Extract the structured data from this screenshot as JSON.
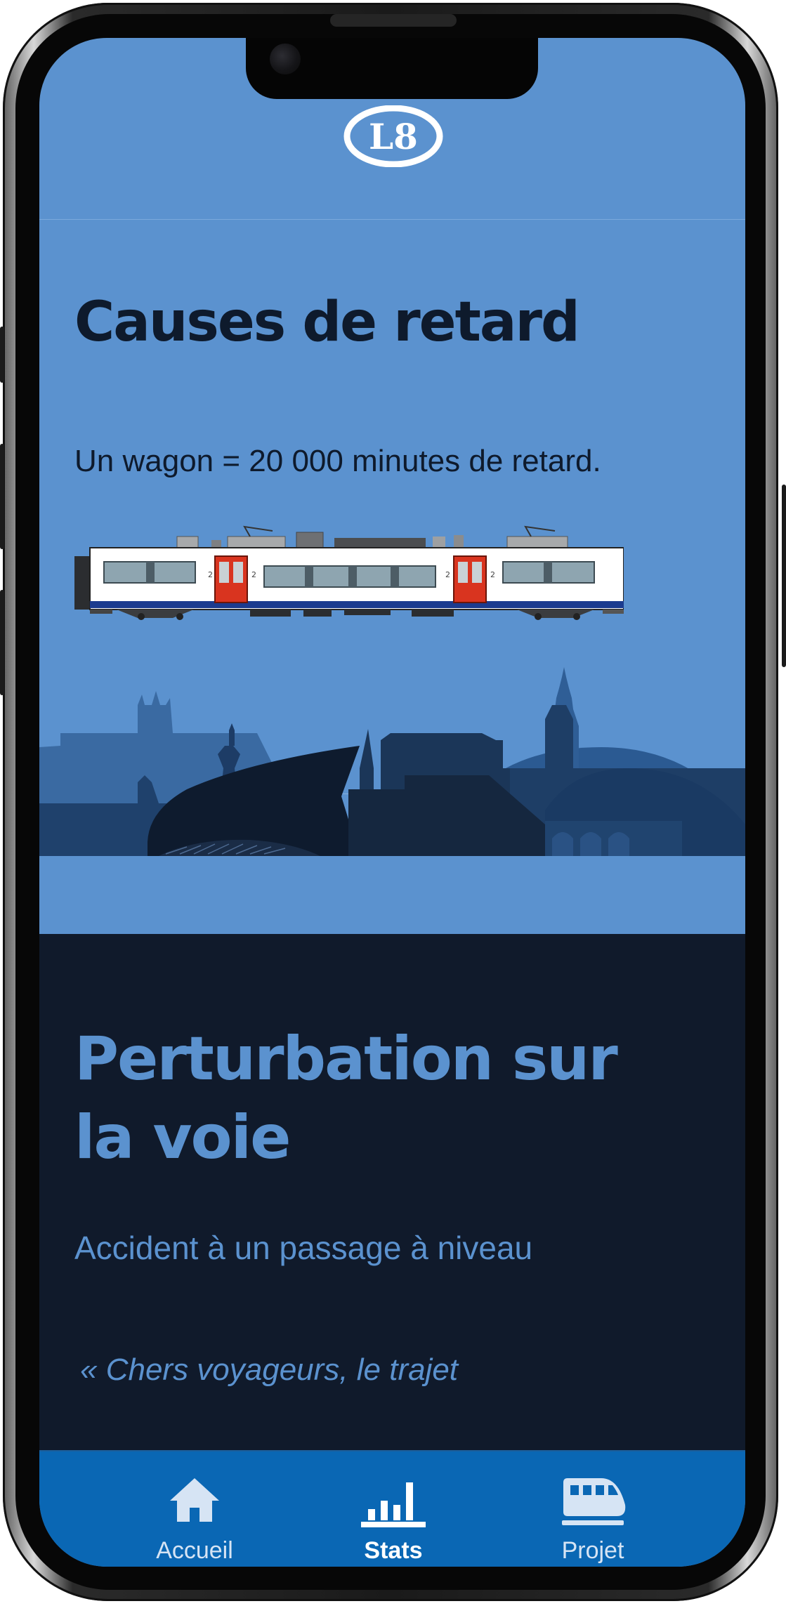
{
  "header": {
    "logo_text": "L8"
  },
  "page": {
    "title": "Causes de retard",
    "subtitle": "Un wagon = 20 000 minutes de retard."
  },
  "train": {
    "car_numbers": [
      "2",
      "2",
      "2",
      "2"
    ]
  },
  "section": {
    "title": "Perturbation sur la voie",
    "cause": "Accident à un passage à niveau",
    "quote": "« Chers voyageurs, le trajet"
  },
  "tabbar": {
    "tabs": [
      {
        "label": "Accueil",
        "icon": "home-icon",
        "active": false
      },
      {
        "label": "Stats",
        "icon": "bar-chart-icon",
        "active": true
      },
      {
        "label": "Projet",
        "icon": "train-icon",
        "active": false
      }
    ]
  },
  "colors": {
    "sky": "#5b92cf",
    "dark": "#101a2b",
    "tabbar": "#0a67b4",
    "tab_inactive": "#d6e4f4",
    "tab_active": "#ffffff"
  }
}
